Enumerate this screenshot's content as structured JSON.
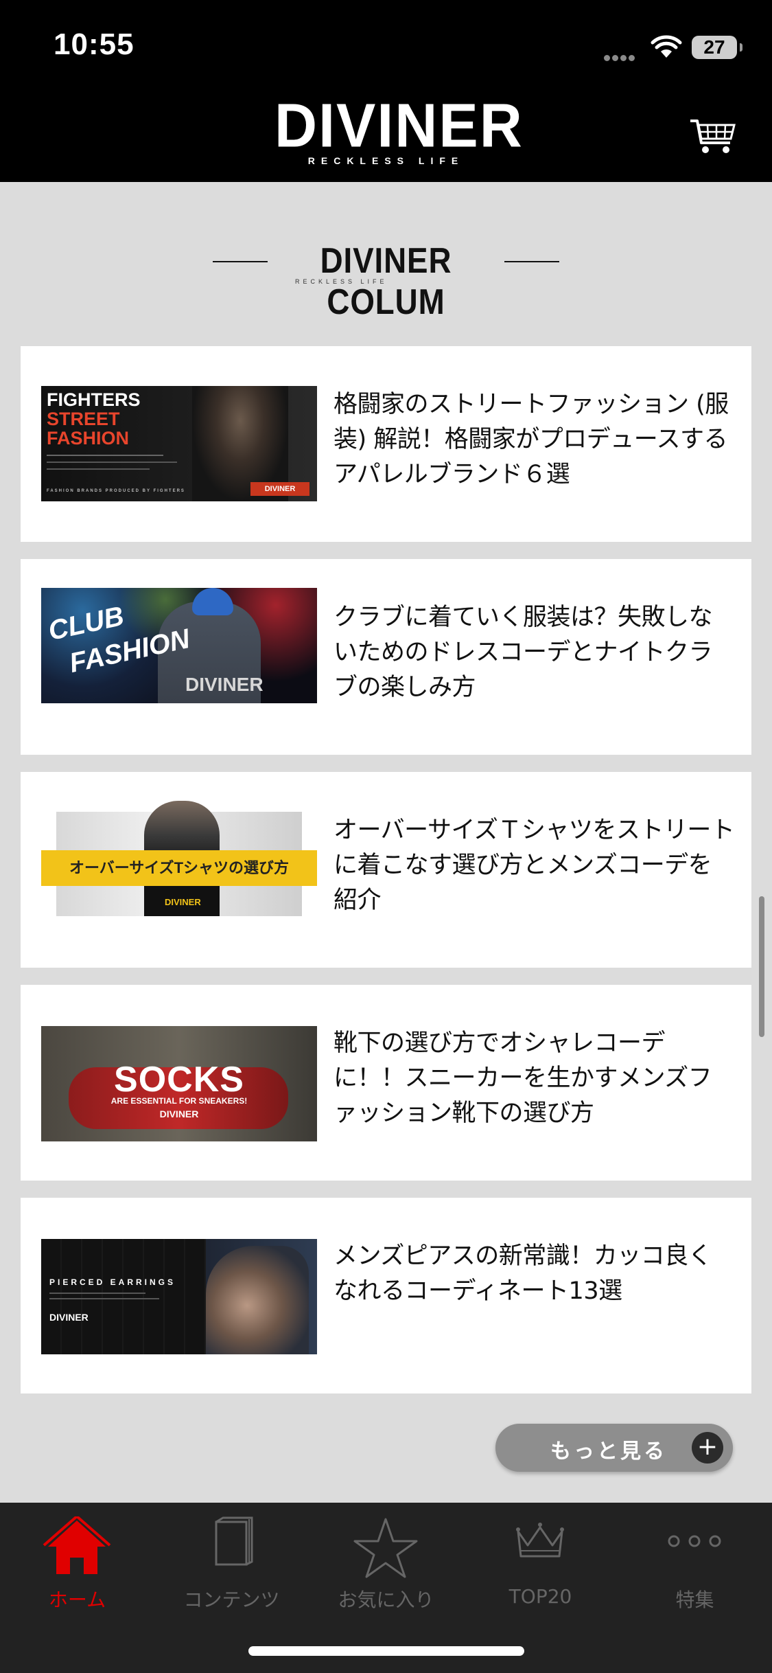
{
  "status_bar": {
    "time": "10:55",
    "battery": "27"
  },
  "header": {
    "logo": "DIVINER",
    "logo_sub": "RECKLESS LIFE"
  },
  "section": {
    "title": "DIVINER COLUM",
    "title_sub": "RECKLESS LIFE"
  },
  "articles": [
    {
      "title": "格闘家のストリートファッション (服装) 解説！格闘家がプロデュースするアパレルブランド６選",
      "thumb_text": [
        "FIGHTERS",
        "STREET",
        "FASHION",
        "DIVINER",
        "FASHION BRANDS PRODUCED BY FIGHTERS"
      ]
    },
    {
      "title": "クラブに着ていく服装は？失敗しないためのドレスコーデとナイトクラブの楽しみ方",
      "thumb_text": [
        "CLUB",
        "FASHION",
        "DIVINER"
      ]
    },
    {
      "title": "オーバーサイズＴシャツをストリートに着こなす選び方とメンズコーデを紹介",
      "thumb_text": [
        "オーバーサイズTシャツの選び方",
        "DIVINER"
      ]
    },
    {
      "title": "靴下の選び方でオシャレコーデに！！スニーカーを生かすメンズファッション靴下の選び方",
      "thumb_text": [
        "SOCKS",
        "ARE ESSENTIAL FOR SNEAKERS!",
        "DIVINER"
      ]
    },
    {
      "title": "メンズピアスの新常識！カッコ良くなれるコーディネート13選",
      "thumb_text": [
        "PIERCED EARRINGS",
        "DIVINER"
      ]
    }
  ],
  "more_button": {
    "label": "もっと見る",
    "icon": "+"
  },
  "tabs": [
    {
      "label": "ホーム",
      "icon": "home-icon",
      "active": true
    },
    {
      "label": "コンテンツ",
      "icon": "book-icon",
      "active": false
    },
    {
      "label": "お気に入り",
      "icon": "star-icon",
      "active": false
    },
    {
      "label": "TOP20",
      "icon": "crown-icon",
      "active": false
    },
    {
      "label": "特集",
      "icon": "more-dots-icon",
      "active": false
    }
  ],
  "colors": {
    "accent": "#e00000",
    "header_bg": "#000000",
    "tab_bg": "#222222",
    "page_bg": "#dcdcdc"
  }
}
